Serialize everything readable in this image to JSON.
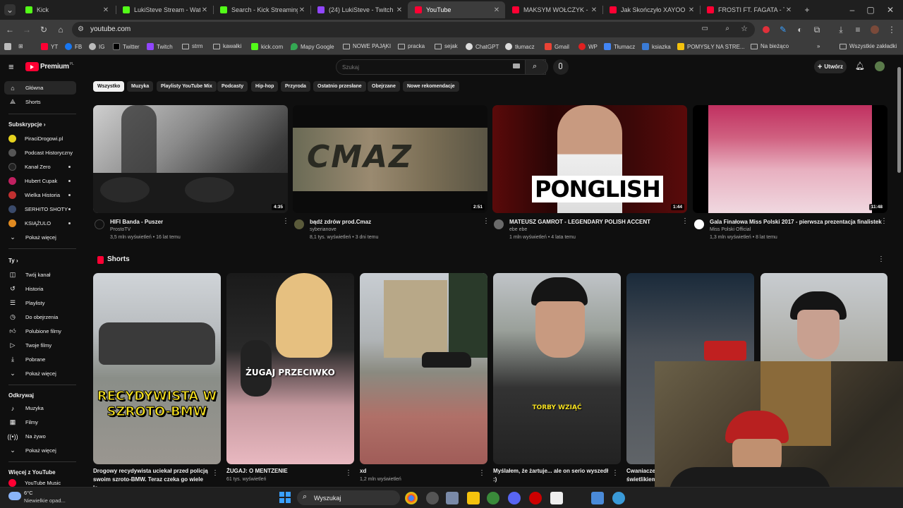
{
  "browser": {
    "tabs": [
      {
        "title": "Kick",
        "color": "#53fc18"
      },
      {
        "title": "LukiSteve Stream - Watch",
        "color": "#53fc18"
      },
      {
        "title": "Search - Kick Streaming",
        "color": "#53fc18"
      },
      {
        "title": "(24) LukiSteve - Twitch",
        "color": "#9146ff"
      },
      {
        "title": "YouTube",
        "color": "#ff0033"
      },
      {
        "title": "MAKSYM WOŁCZYK - DU",
        "color": "#ff0033"
      },
      {
        "title": "Jak Skończyło XAYOO INE",
        "color": "#ff0033"
      },
      {
        "title": "FROSTI FT. FAGATA - TOX",
        "color": "#ff0033"
      }
    ],
    "url": "youtube.com",
    "bookmarks": [
      "YT",
      "FB",
      "IG",
      "Twitter",
      "Twitch",
      "strm",
      "kawałki",
      "kick.com",
      "Mapy Google",
      "NOWE PAJĄKI",
      "pracka",
      "sejak",
      "ChatGPT",
      "tłumacz",
      "Gmail",
      "WP",
      "Tłumacz",
      "ksiazka",
      "POMYSŁY NA STRE...",
      "Na bieżąco"
    ],
    "all_bookmarks": "Wszystkie zakładki"
  },
  "youtube": {
    "logo": "Premium",
    "logo_region": "PL",
    "search_placeholder": "Szukaj",
    "create_label": "Utwórz",
    "chips": [
      "Wszystko",
      "Muzyka",
      "Playlisty YouTube Mix",
      "Podcasty",
      "Hip-hop",
      "Przyroda",
      "Ostatnio przesłane",
      "Obejrzane",
      "Nowe rekomendacje"
    ],
    "sidebar": {
      "main": [
        {
          "label": "Główna",
          "icon": "home-icon"
        },
        {
          "label": "Shorts",
          "icon": "shorts-icon"
        }
      ],
      "subs_heading": "Subskrypcje",
      "subs": [
        {
          "label": "PiraciDrogowi.pl",
          "color": "#e6d21e"
        },
        {
          "label": "Podcast Historyczny",
          "color": "#444"
        },
        {
          "label": "Kanał Zero",
          "color": "#1a1a1a"
        },
        {
          "label": "Hubert Cupak",
          "color": "#c02060"
        },
        {
          "label": "Wielka Historia",
          "color": "#c03030"
        },
        {
          "label": "SERHITO SHOTY",
          "color": "#3a4a6a"
        },
        {
          "label": "KSIĄŻULO",
          "color": "#e08a20"
        },
        {
          "label": "Pokaż więcej",
          "color": ""
        }
      ],
      "you_heading": "Ty",
      "you": [
        {
          "label": "Twój kanał",
          "icon": "channel-icon"
        },
        {
          "label": "Historia",
          "icon": "history-icon"
        },
        {
          "label": "Playlisty",
          "icon": "playlist-icon"
        },
        {
          "label": "Do obejrzenia",
          "icon": "watch-later-icon"
        },
        {
          "label": "Polubione filmy",
          "icon": "like-icon"
        },
        {
          "label": "Twoje filmy",
          "icon": "your-videos-icon"
        },
        {
          "label": "Pobrane",
          "icon": "download-icon"
        },
        {
          "label": "Pokaż więcej",
          "icon": "chevron-down-icon"
        }
      ],
      "explore_heading": "Odkrywaj",
      "explore": [
        {
          "label": "Muzyka",
          "icon": "music-icon"
        },
        {
          "label": "Filmy",
          "icon": "film-icon"
        },
        {
          "label": "Na żywo",
          "icon": "live-icon"
        },
        {
          "label": "Pokaż więcej",
          "icon": "chevron-down-icon"
        }
      ],
      "more_heading": "Więcej z YouTube",
      "more": [
        {
          "label": "YouTube Music"
        }
      ]
    },
    "videos": [
      {
        "title": "HIFI Banda - Puszer",
        "channel": "ProstoTV",
        "meta": "3,5 mln wyświetleń • 16 lat temu",
        "duration": "4:35"
      },
      {
        "title": "bądź zdrów prod.Cmaz",
        "channel": "syberianove",
        "meta": "8,1 tys. wyświetleń • 3 dni temu",
        "duration": "2:51",
        "thumb_text": "CMAZ"
      },
      {
        "title": "MATEUSZ GAMROT - LEGENDARY POLISH ACCENT",
        "channel": "ebe ebe",
        "meta": "1 mln wyświetleń • 4 lata temu",
        "duration": "1:44",
        "thumb_text": "PONGLISH"
      },
      {
        "title": "Gala Finałowa Miss Polski 2017 - pierwsza prezentacja finalistek",
        "channel": "Miss Polski Official",
        "meta": "1,3 mln wyświetleń • 8 lat temu",
        "duration": "11:48"
      }
    ],
    "shorts_heading": "Shorts",
    "shorts": [
      {
        "title": "Drogowy recydywista uciekał przed policją swoim szroto-BMW. Teraz czeka go wiele la...",
        "meta": "",
        "thumb_text": "RECYDYWISTA W SZROTO-BMW"
      },
      {
        "title": "ŻUGAJ: O MENTZENIE",
        "meta": "61 tys. wyświetleń",
        "thumb_text": "ŻUGAJ PRZECIWKO"
      },
      {
        "title": "xd",
        "meta": "1,2 mln wyświetleń",
        "thumb_text": ""
      },
      {
        "title": "Myślałem, że żartuje... ale on serio wyszedł :)",
        "meta": "",
        "thumb_text": "TORBY WZIĄĆ"
      },
      {
        "title": "Cwaniaczek świetlikiem",
        "meta": "",
        "thumb_text": ""
      }
    ]
  },
  "taskbar": {
    "weather_temp": "6°C",
    "weather_desc": "Niewielkie opad...",
    "search_label": "Wyszukaj"
  }
}
